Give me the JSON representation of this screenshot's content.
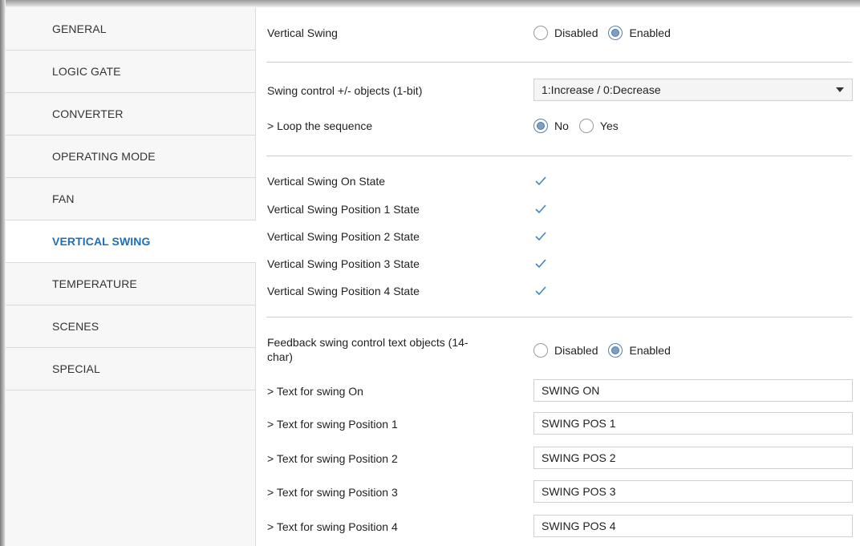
{
  "sidebar": {
    "items": [
      {
        "label": "GENERAL"
      },
      {
        "label": "LOGIC GATE"
      },
      {
        "label": "CONVERTER"
      },
      {
        "label": "OPERATING MODE"
      },
      {
        "label": "FAN"
      },
      {
        "label": "VERTICAL SWING",
        "active": true
      },
      {
        "label": "TEMPERATURE"
      },
      {
        "label": "SCENES"
      },
      {
        "label": "SPECIAL"
      }
    ]
  },
  "main": {
    "vertical_swing": {
      "label": "Vertical Swing",
      "options": [
        "Disabled",
        "Enabled"
      ],
      "selected": "Enabled"
    },
    "swing_control": {
      "label": "Swing control +/- objects (1-bit)",
      "value": "1:Increase / 0:Decrease"
    },
    "loop_sequence": {
      "label": "> Loop the sequence",
      "options": [
        "No",
        "Yes"
      ],
      "selected": "No"
    },
    "state_objects": [
      {
        "label": "Vertical Swing On State",
        "checked": true
      },
      {
        "label": "Vertical Swing Position 1 State",
        "checked": true
      },
      {
        "label": "Vertical Swing Position 2 State",
        "checked": true
      },
      {
        "label": "Vertical Swing Position 3 State",
        "checked": true
      },
      {
        "label": "Vertical Swing Position 4 State",
        "checked": true
      }
    ],
    "feedback_text": {
      "label_line1": "Feedback swing control text objects (14-",
      "label_line2": "char)",
      "options": [
        "Disabled",
        "Enabled"
      ],
      "selected": "Enabled"
    },
    "text_fields": [
      {
        "label": "> Text for swing On",
        "value": "SWING ON"
      },
      {
        "label": "> Text for swing Position 1",
        "value": "SWING POS 1"
      },
      {
        "label": "> Text for swing Position 2",
        "value": "SWING POS 2"
      },
      {
        "label": "> Text for swing Position 3",
        "value": "SWING POS 3"
      },
      {
        "label": "> Text for swing Position 4",
        "value": "SWING POS 4"
      }
    ]
  },
  "colors": {
    "accent": "#1c6fb8",
    "check": "#3b86c8",
    "separator": "#cfcfcf"
  },
  "icons": {
    "checkbox": "checkmark-icon",
    "dropdown": "caret-down-icon"
  }
}
